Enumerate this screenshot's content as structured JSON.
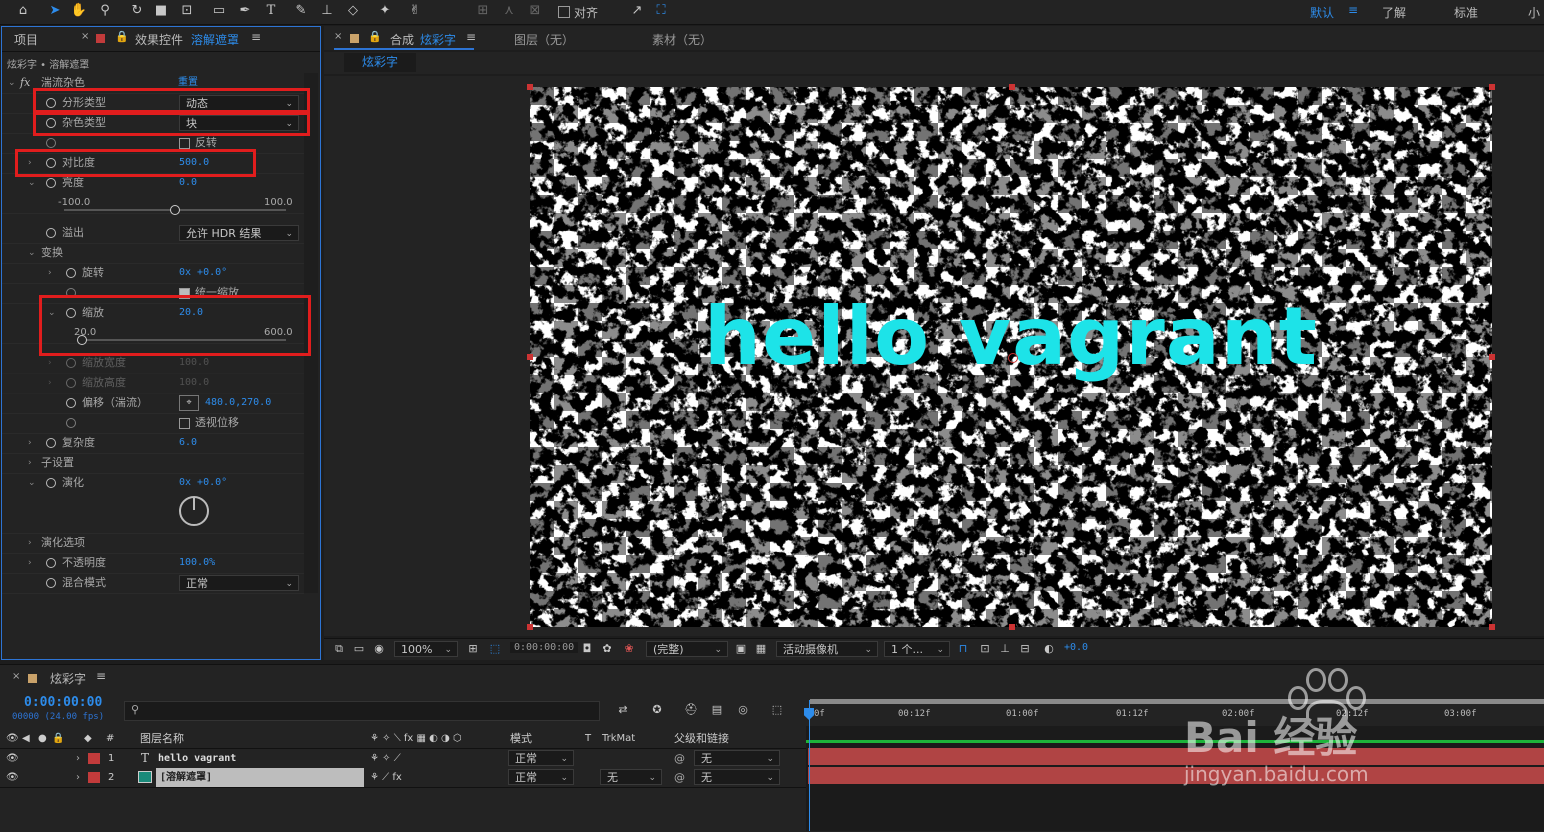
{
  "toolbar": {
    "align_label": "对齐",
    "workspaces": [
      "默认",
      "了解",
      "标准",
      "小"
    ],
    "active_workspace": "默认",
    "tools": [
      "home-icon",
      "selection-arrow-icon",
      "hand-icon",
      "zoom-icon",
      "rotate-icon",
      "camera-orbit-icon",
      "pan-behind-icon",
      "rectangle-icon",
      "pen-icon",
      "type-icon",
      "brush-icon",
      "clone-stamp-icon",
      "eraser-icon",
      "roto-brush-icon",
      "puppet-pin-icon"
    ]
  },
  "effect_controls": {
    "tab_project": "项目",
    "tab_effect_prefix": "效果控件",
    "tab_effect_name": "溶解遮罩",
    "breadcrumb": "炫彩字 • 溶解遮罩",
    "effect_name": "湍流杂色",
    "reset_label": "重置",
    "params": {
      "fractal_type": {
        "label": "分形类型",
        "value": "动态"
      },
      "noise_type": {
        "label": "杂色类型",
        "value": "块"
      },
      "invert": {
        "label": "反转",
        "checked": false
      },
      "contrast": {
        "label": "对比度",
        "value": "500.0"
      },
      "brightness": {
        "label": "亮度",
        "value": "0.0",
        "min": "-100.0",
        "max": "100.0",
        "fraction": 0.5
      },
      "overflow": {
        "label": "溢出",
        "value": "允许 HDR 结果"
      },
      "transform": {
        "label": "变换"
      },
      "rotation": {
        "label": "旋转",
        "value": "0x +0.0°"
      },
      "uniform_scale": {
        "label": "统一缩放",
        "checked": true
      },
      "scale": {
        "label": "缩放",
        "value": "20.0",
        "min": "20.0",
        "max": "600.0",
        "fraction": 0.0
      },
      "scale_width": {
        "label": "缩放宽度",
        "value": "100.0"
      },
      "scale_height": {
        "label": "缩放高度",
        "value": "100.0"
      },
      "offset": {
        "label": "偏移（湍流）",
        "value": "480.0,270.0"
      },
      "perspective": {
        "label": "透视位移",
        "checked": false
      },
      "complexity": {
        "label": "复杂度",
        "value": "6.0"
      },
      "sub_settings": {
        "label": "子设置"
      },
      "evolution": {
        "label": "演化",
        "value": "0x +0.0°"
      },
      "evolution_options": {
        "label": "演化选项"
      },
      "opacity": {
        "label": "不透明度",
        "value": "100.0%"
      },
      "blend_mode": {
        "label": "混合模式",
        "value": "正常"
      }
    }
  },
  "composition": {
    "tab_prefix": "合成",
    "tab_name": "炫彩字",
    "layer_tab": "图层（无）",
    "footage_tab": "素材（无）",
    "sub_tab": "炫彩字",
    "text": "hello vagrant",
    "text_color": "#1de3e8",
    "zoom": "100%",
    "timecode": "0:00:00:00",
    "resolution": "(完整)",
    "camera": "活动摄像机",
    "views": "1 个...",
    "exposure": "+0.0"
  },
  "timeline": {
    "comp_name": "炫彩字",
    "timecode": "0:00:00:00",
    "frame_info": "00000 (24.00 fps)",
    "columns": {
      "num": "#",
      "name": "图层名称",
      "mode": "模式",
      "t": "T",
      "trkmat": "TrkMat",
      "parent": "父级和链接"
    },
    "ruler": [
      "0f",
      "00:12f",
      "01:00f",
      "01:12f",
      "02:00f",
      "02:12f",
      "03:00f"
    ],
    "layers": [
      {
        "num": "1",
        "type": "T",
        "name": "hello vagrant",
        "mode": "正常",
        "trkmat": "",
        "parent": "无",
        "label_color": "#c23b3b"
      },
      {
        "num": "2",
        "type": "",
        "name": "[溶解遮罩]",
        "mode": "正常",
        "trkmat": "无",
        "parent": "无",
        "label_color": "#c23b3b"
      }
    ]
  },
  "watermark": {
    "brand": "Bai 经验",
    "url": "jingyan.baidu.com"
  }
}
